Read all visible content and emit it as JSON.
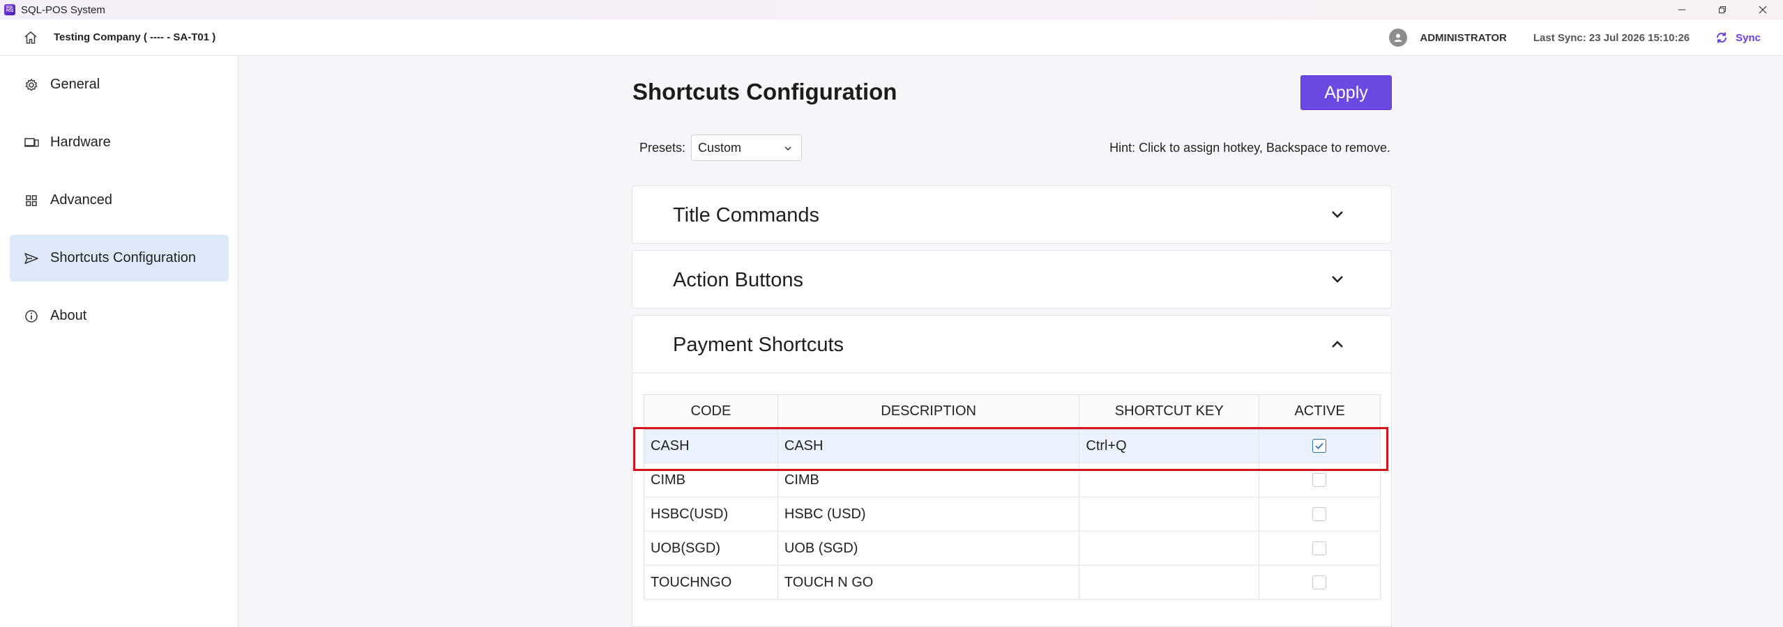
{
  "window": {
    "title": "SQL-POS System",
    "logo_text": "SQL POS"
  },
  "header": {
    "company": "Testing Company ( ---- - SA-T01 )",
    "username": "ADMINISTRATOR",
    "last_sync": "Last Sync: 23 Jul 2026 15:10:26",
    "sync_label": "Sync",
    "accent_color": "#6c3fe0"
  },
  "sidebar": {
    "items": [
      {
        "label": "General",
        "icon": "gear-icon"
      },
      {
        "label": "Hardware",
        "icon": "devices-icon"
      },
      {
        "label": "Advanced",
        "icon": "grid-icon"
      },
      {
        "label": "Shortcuts Configuration",
        "icon": "send-icon",
        "active": true
      },
      {
        "label": "About",
        "icon": "info-icon"
      }
    ]
  },
  "main": {
    "title": "Shortcuts Configuration",
    "apply_label": "Apply",
    "presets_label": "Presets:",
    "presets_value": "Custom",
    "hint": "Hint: Click to assign hotkey, Backspace to remove.",
    "sections": [
      {
        "title": "Title Commands",
        "expanded": false
      },
      {
        "title": "Action Buttons",
        "expanded": false
      },
      {
        "title": "Payment Shortcuts",
        "expanded": true
      }
    ],
    "table": {
      "columns": [
        "CODE",
        "DESCRIPTION",
        "SHORTCUT KEY",
        "ACTIVE"
      ],
      "rows": [
        {
          "code": "CASH",
          "description": "CASH",
          "shortcut": "Ctrl+Q",
          "active": true,
          "selected": true
        },
        {
          "code": "CIMB",
          "description": "CIMB",
          "shortcut": "",
          "active": false
        },
        {
          "code": "HSBC(USD)",
          "description": "HSBC (USD)",
          "shortcut": "",
          "active": false
        },
        {
          "code": "UOB(SGD)",
          "description": "UOB (SGD)",
          "shortcut": "",
          "active": false
        },
        {
          "code": "TOUCHNGO",
          "description": "TOUCH N GO",
          "shortcut": "",
          "active": false
        }
      ]
    }
  }
}
